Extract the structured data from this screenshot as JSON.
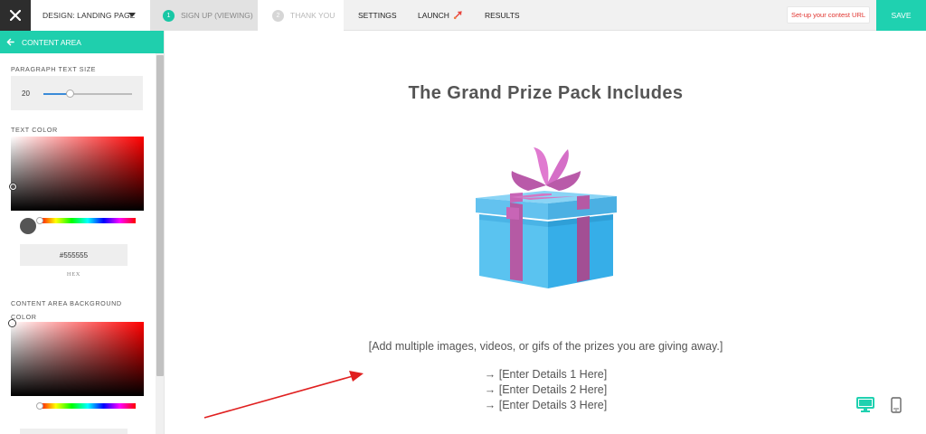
{
  "topbar": {
    "design_label": "DESIGN: LANDING PAGE",
    "steps": [
      {
        "num": "1",
        "label": "SIGN UP (VIEWING)"
      },
      {
        "num": "2",
        "label": "THANK YOU"
      }
    ],
    "nav": [
      "SETTINGS",
      "LAUNCH",
      "RESULTS"
    ],
    "setup_url_label": "Set-up your contest URL",
    "save_label": "SAVE"
  },
  "sidebar": {
    "title": "CONTENT AREA",
    "paragraph_size_label": "PARAGRAPH TEXT SIZE",
    "paragraph_size_value": "20",
    "paragraph_size_slider_fraction": 0.3,
    "text_color_label": "TEXT COLOR",
    "text_color_hex": "#555555",
    "hex_label": "HEX",
    "bg_color_label_line1": "CONTENT AREA BACKGROUND",
    "bg_color_label_line2": "COLOR"
  },
  "canvas": {
    "headline": "The Grand Prize Pack Includes",
    "prize_note": "[Add multiple images, videos, or gifs of the prizes you are giving away.]",
    "details": [
      "→ [Enter Details 1 Here]",
      "→ [Enter Details 2 Here]",
      "→ [Enter Details 3 Here]"
    ]
  },
  "icons": {
    "close": "close-icon",
    "back": "arrow-left-icon",
    "launch": "rocket-icon",
    "desktop": "desktop-icon",
    "mobile": "mobile-icon",
    "gift": "gift-box-icon"
  },
  "colors": {
    "accent": "#1fd1b0",
    "text": "#555555",
    "setup_url": "#e0342f",
    "arrow": "#e02020"
  }
}
